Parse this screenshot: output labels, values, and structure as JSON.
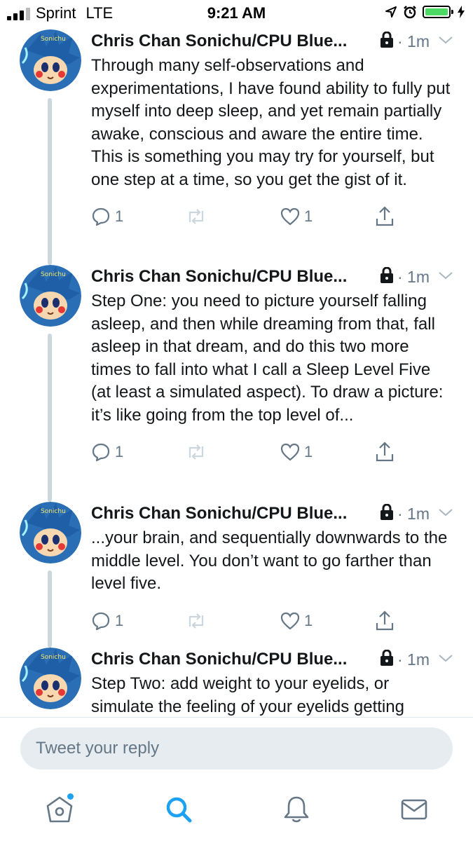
{
  "status_bar": {
    "carrier": "Sprint",
    "network": "LTE",
    "time": "9:21 AM",
    "battery_color": "#4cd964",
    "icons": [
      "signal-icon",
      "location-arrow-icon",
      "alarm-clock-icon",
      "battery-icon",
      "charging-bolt-icon"
    ]
  },
  "colors": {
    "accent": "#1da1f2",
    "text": "#14171a",
    "muted": "#657786",
    "thread_line": "#ccd6dd",
    "reply_bg": "#e6ecf0"
  },
  "tweets": [
    {
      "author": "Chris Chan Sonichu/CPU Blue...",
      "time": "1m",
      "text": "Through many self-observations and experimentations, I have found ability to fully put myself into deep sleep, and yet remain partially awake, conscious and aware the entire time. This is something you may try for yourself, but one step at a time, so you get the gist of it.",
      "replies": "1",
      "likes": "1"
    },
    {
      "author": "Chris Chan Sonichu/CPU Blue...",
      "time": "1m",
      "text": "Step One: you need to picture yourself falling asleep, and then while dreaming from that, fall asleep in that dream, and do this two more times to fall into what I call a Sleep Level Five (at least a simulated aspect). To draw a picture: it’s like going from the top level of...",
      "replies": "1",
      "likes": "1"
    },
    {
      "author": "Chris Chan Sonichu/CPU Blue...",
      "time": "1m",
      "text": "...your brain, and sequentially downwards to the middle level. You don’t want to go farther than level five.",
      "replies": "1",
      "likes": "1"
    },
    {
      "author": "Chris Chan Sonichu/CPU Blue...",
      "time": "1m",
      "text": "Step Two: add weight to your eyelids, or simulate the feeling of your eyelids getting heavy",
      "replies": "",
      "likes": ""
    }
  ],
  "avatar_text": "Sonichu",
  "composer": {
    "placeholder": "Tweet your reply"
  },
  "bottom_nav": [
    {
      "icon": "home-icon",
      "label": "Home"
    },
    {
      "icon": "search-icon",
      "label": "Search"
    },
    {
      "icon": "notifications-bell-icon",
      "label": "Notifications"
    },
    {
      "icon": "messages-envelope-icon",
      "label": "Messages"
    }
  ]
}
